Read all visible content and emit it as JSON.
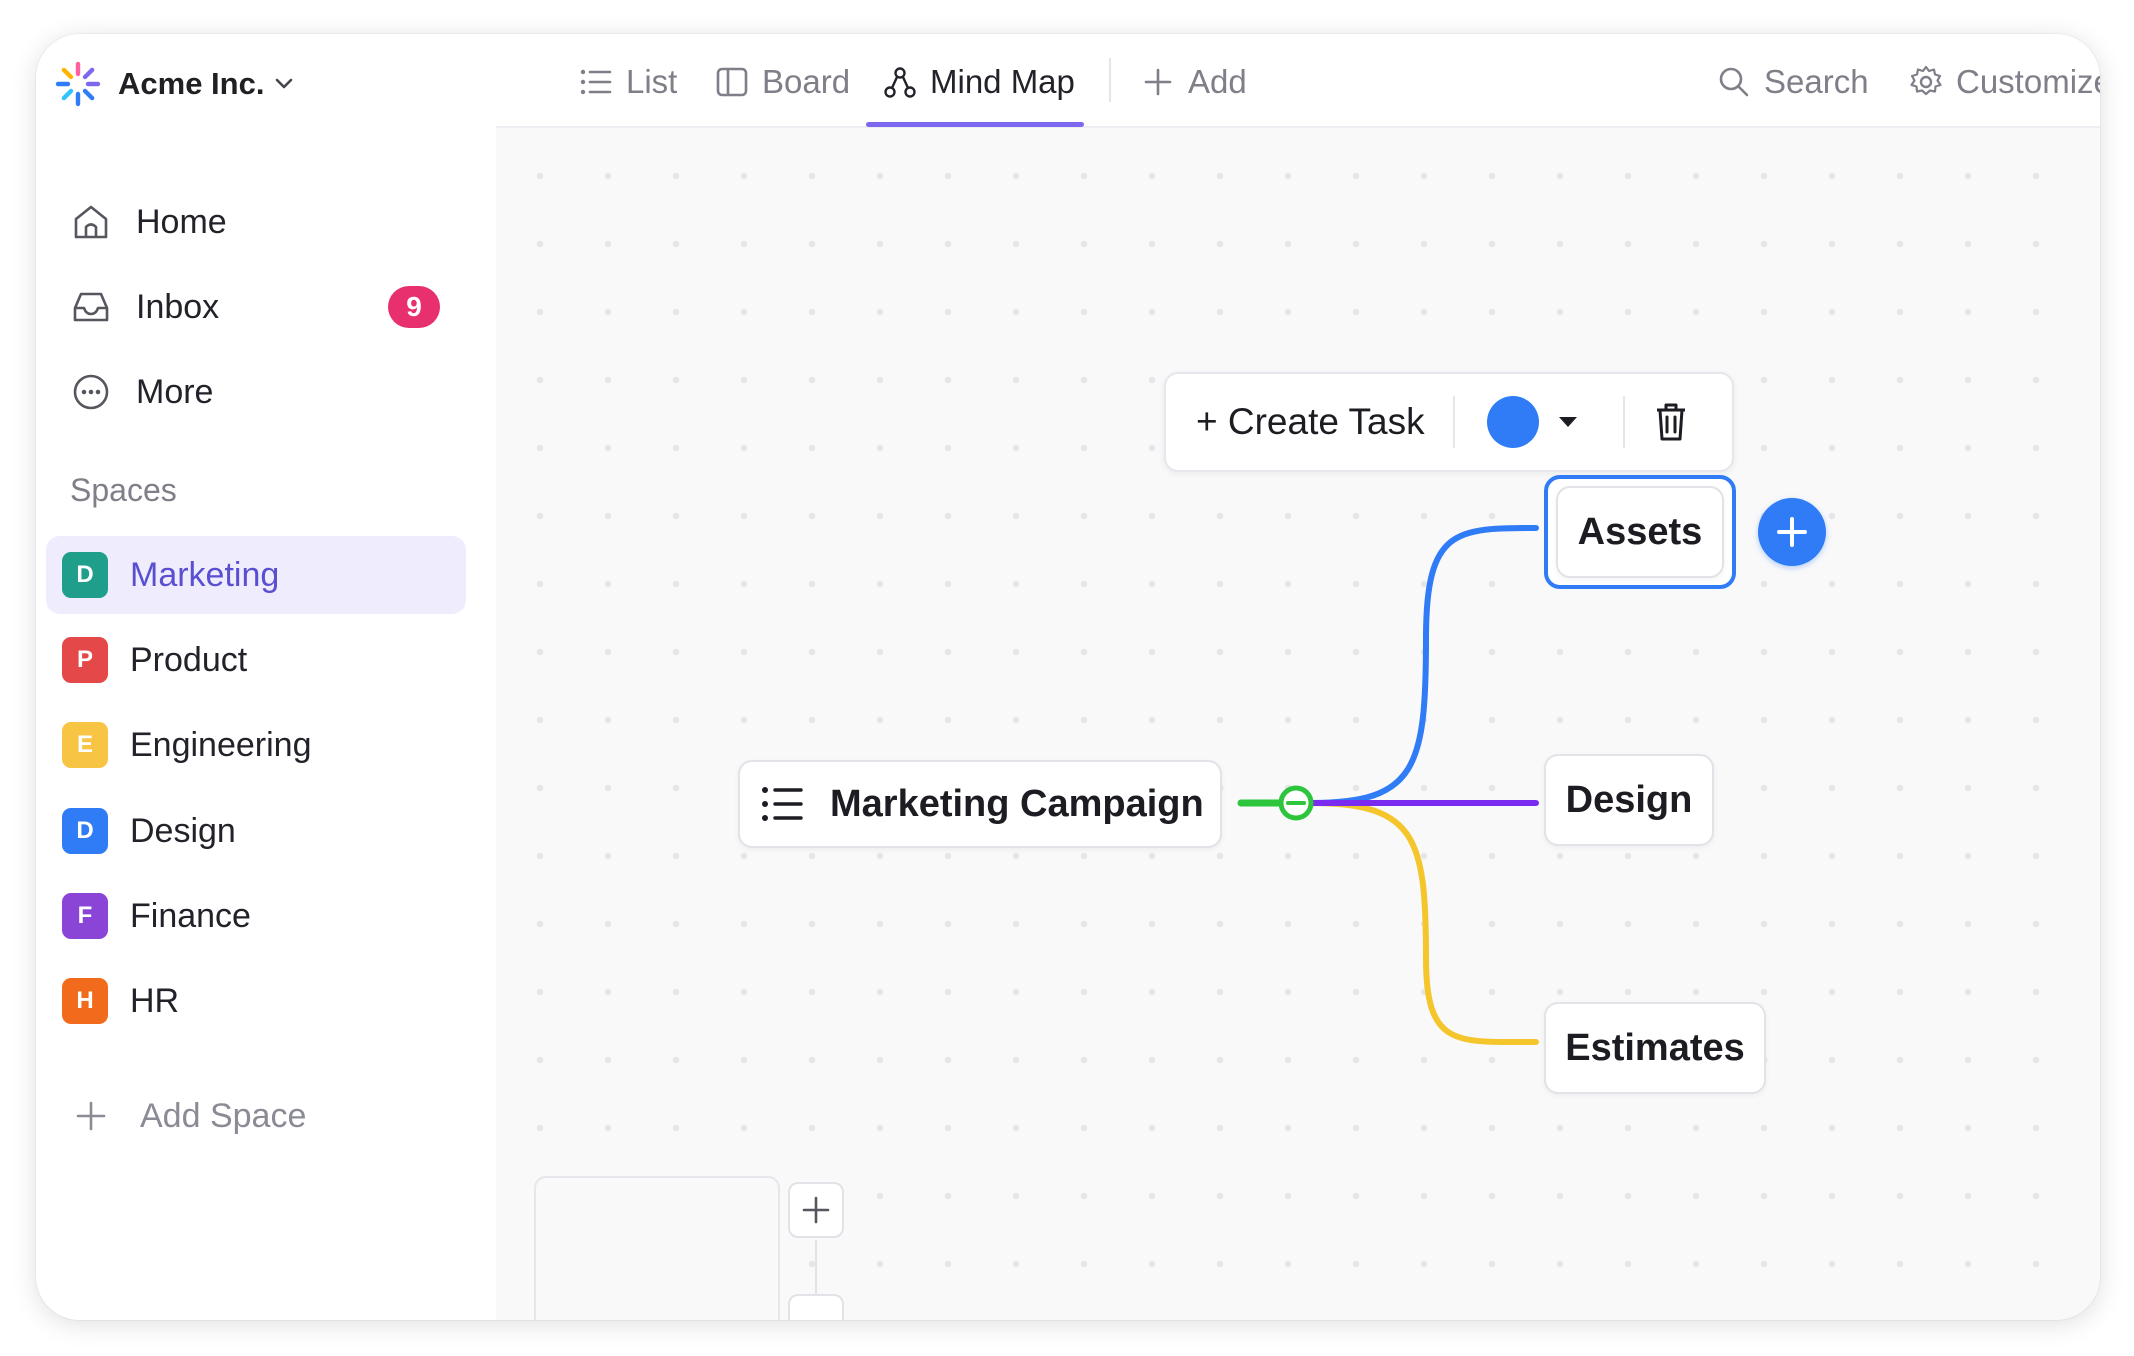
{
  "brand": {
    "name": "Acme Inc.",
    "logo_icon": "sparkle-logo-icon",
    "chevron_icon": "chevron-down-icon"
  },
  "nav": {
    "items": [
      {
        "label": "Home",
        "icon": "home-icon"
      },
      {
        "label": "Inbox",
        "icon": "inbox-icon",
        "badge": "9"
      },
      {
        "label": "More",
        "icon": "more-icon"
      }
    ]
  },
  "spaces": {
    "title": "Spaces",
    "items": [
      {
        "initial": "D",
        "label": "Marketing",
        "color": "#1f9e8c",
        "active": true
      },
      {
        "initial": "P",
        "label": "Product",
        "color": "#e44848"
      },
      {
        "initial": "E",
        "label": "Engineering",
        "color": "#f7c444"
      },
      {
        "initial": "D",
        "label": "Design",
        "color": "#2f7cf6"
      },
      {
        "initial": "F",
        "label": "Finance",
        "color": "#8b45d6"
      },
      {
        "initial": "H",
        "label": "HR",
        "color": "#f26a1b"
      }
    ],
    "add_label": "Add Space"
  },
  "tabs": [
    {
      "label": "List",
      "icon": "list-icon"
    },
    {
      "label": "Board",
      "icon": "board-icon"
    },
    {
      "label": "Mind Map",
      "icon": "mind-map-icon",
      "active": true
    },
    {
      "label": "Add",
      "icon": "plus-icon"
    }
  ],
  "topbar_right": {
    "search_label": "Search",
    "customize_label": "Customize"
  },
  "mindmap": {
    "root": {
      "label": "Marketing Campaign",
      "icon": "list-icon"
    },
    "children": [
      {
        "label": "Assets",
        "link_color": "#2f7cf6",
        "selected": true
      },
      {
        "label": "Design",
        "link_color": "#7a2bf0"
      },
      {
        "label": "Estimates",
        "link_color": "#f5c52c"
      }
    ],
    "root_link_color": "#2cc53b",
    "toolbar": {
      "create_task_label": "+ Create Task",
      "color": "#2f7cf6",
      "delete_icon": "trash-icon"
    },
    "add_child_icon": "plus-icon"
  },
  "colors": {
    "accent": "#7b68ee",
    "badge": "#e9306f",
    "blue": "#2f7cf6"
  }
}
